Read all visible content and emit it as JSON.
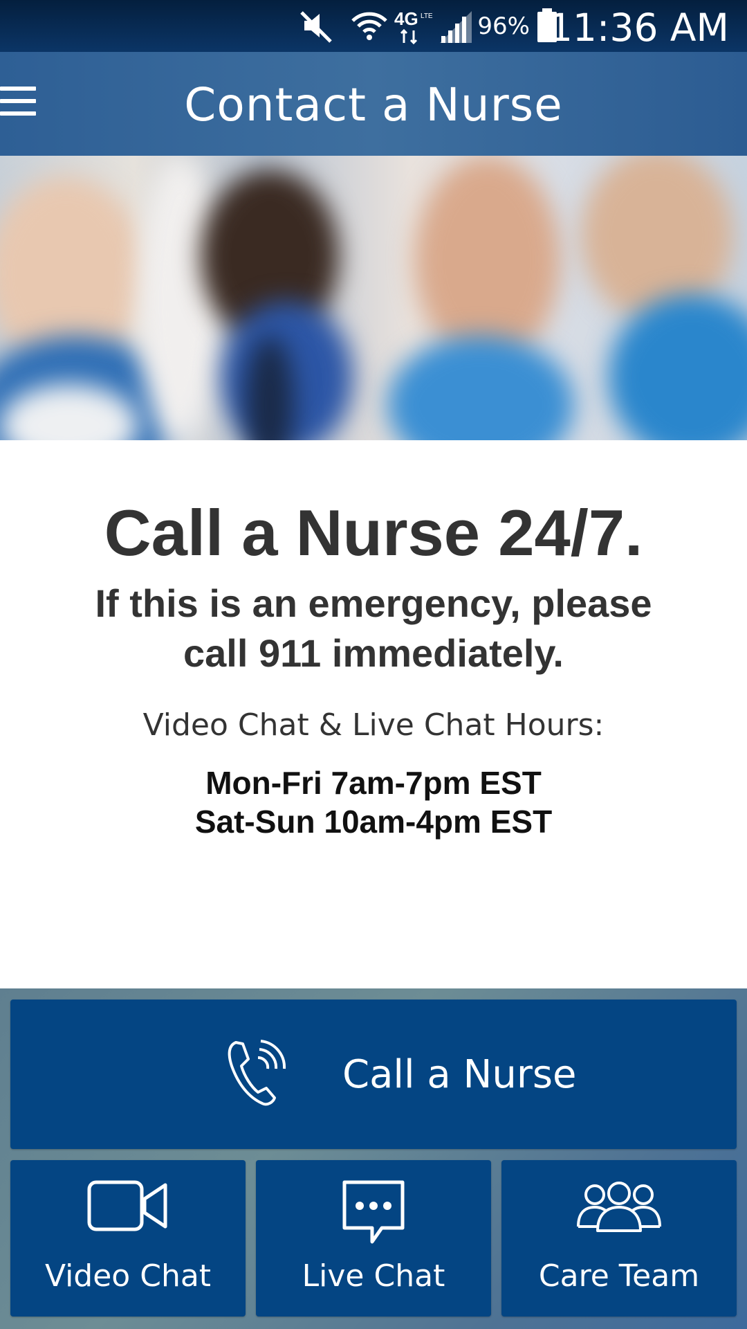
{
  "status_bar": {
    "battery_percent": "96%",
    "time": "11:36 AM",
    "icons": [
      "mute-icon",
      "wifi-icon",
      "4g-lte-icon",
      "signal-icon",
      "battery-icon"
    ]
  },
  "header": {
    "title": "Contact a Nurse",
    "menu_icon": "hamburger-menu-icon"
  },
  "main": {
    "headline": "Call a Nurse 24/7.",
    "emergency_notice": "If this is an emergency, please call 911 immediately.",
    "hours_label": "Video Chat & Live Chat Hours:",
    "hours": [
      "Mon-Fri 7am-7pm EST",
      "Sat-Sun 10am-4pm EST"
    ]
  },
  "actions": {
    "call": {
      "label": "Call a Nurse",
      "icon": "phone-icon"
    },
    "video": {
      "label": "Video Chat",
      "icon": "video-camera-icon"
    },
    "live": {
      "label": "Live Chat",
      "icon": "chat-bubble-icon"
    },
    "team": {
      "label": "Care Team",
      "icon": "people-group-icon"
    }
  },
  "colors": {
    "button_bg": "#044583",
    "app_bar": "#2e5f95",
    "status_bar": "#0b3566",
    "text_dark": "#333333"
  }
}
